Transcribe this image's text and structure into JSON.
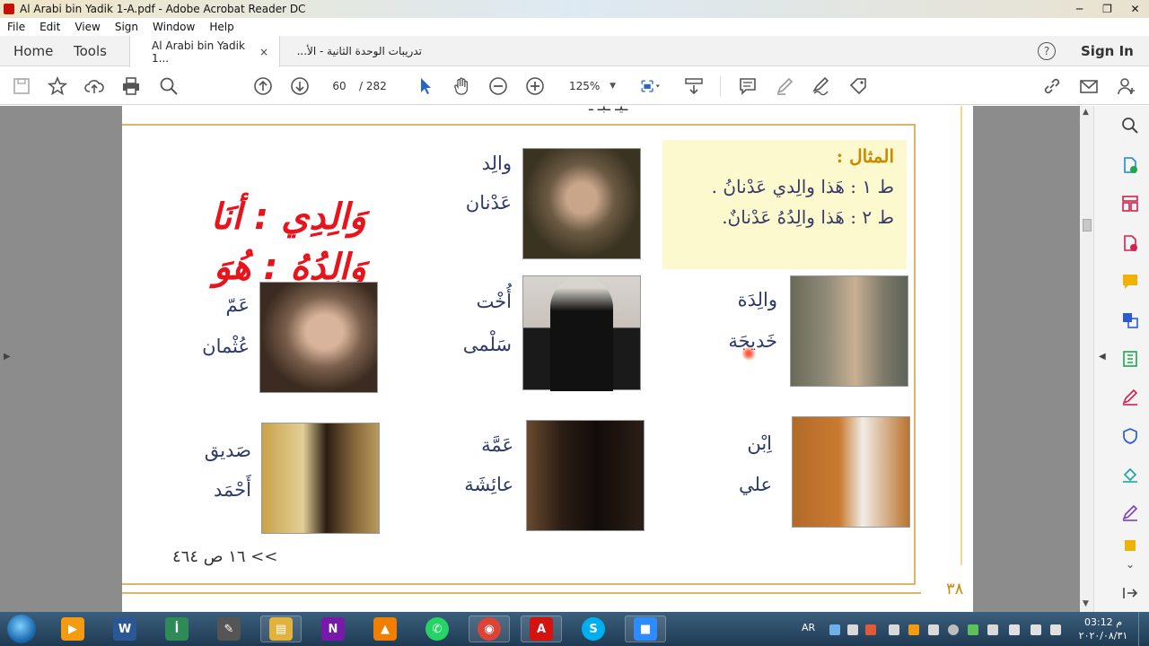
{
  "window": {
    "title": "Al Arabi bin Yadik 1-A.pdf - Adobe Acrobat Reader DC",
    "controls": [
      "─",
      "❐",
      "✕"
    ]
  },
  "menu": [
    "File",
    "Edit",
    "View",
    "Sign",
    "Window",
    "Help"
  ],
  "tabs": {
    "home": "Home",
    "tools": "Tools",
    "docs": [
      {
        "label": "Al Arabi bin Yadik 1...",
        "close": "×",
        "active": true
      },
      {
        "label": "تدريبات الوحدة الثانية - الأ...",
        "active": false
      }
    ],
    "help": "?",
    "signin": "Sign In"
  },
  "toolbar": {
    "page_current": "60",
    "page_total": "/ 282",
    "zoom": "125%",
    "zoom_dropdown": "▼"
  },
  "document": {
    "top_cut_text": "ـيـ ـبـ ـ",
    "example_label": "المثال :",
    "example_line1": "ط ١ : هَذا والِدي عَدْنانُ .",
    "example_line2": "ط ٢ : هَذا والِدُهُ عَدْنانٌ.",
    "red_line1": "وَالِدِي : أنَا",
    "red_line2": "وَالِدُهُ : هُوَ",
    "people": [
      {
        "relation": "والِد",
        "name": "عَدْنان"
      },
      {
        "relation": "والِدَة",
        "name": "خَديجَة"
      },
      {
        "relation": "أُخْت",
        "name": "سَلْمى"
      },
      {
        "relation": "عَمّ",
        "name": "عُثْمان"
      },
      {
        "relation": "اِبْن",
        "name": "علي"
      },
      {
        "relation": "عَمَّة",
        "name": "عائِشَة"
      },
      {
        "relation": "صَديق",
        "name": "أَحْمَد"
      }
    ],
    "footnote": ">> ١٦ ص ٤٦٤",
    "page_number": "٣٨"
  },
  "taskbar": {
    "apps": [
      {
        "name": "media-player",
        "label": "▶",
        "color": "#f39c12"
      },
      {
        "name": "word",
        "label": "W",
        "color": "#2b5797"
      },
      {
        "name": "arabic-app",
        "label": "أ",
        "color": "#2e8b57"
      },
      {
        "name": "pen-tool",
        "label": "✎",
        "color": "#555555"
      },
      {
        "name": "file-explorer",
        "label": "▤",
        "color": "#e2b33c"
      },
      {
        "name": "onenote",
        "label": "N",
        "color": "#7719aa"
      },
      {
        "name": "vlc",
        "label": "▲",
        "color": "#f07e00"
      },
      {
        "name": "whatsapp",
        "label": "✆",
        "color": "#25d366"
      },
      {
        "name": "chrome",
        "label": "◉",
        "color": "#db4437"
      },
      {
        "name": "acrobat",
        "label": "A",
        "color": "#d4120e"
      },
      {
        "name": "skype",
        "label": "S",
        "color": "#00aff0"
      },
      {
        "name": "zoom",
        "label": "■",
        "color": "#2d8cff"
      }
    ],
    "lang": "AR",
    "time": "03:12 م",
    "date": "٢٠٢٠/٠٨/٣١"
  }
}
